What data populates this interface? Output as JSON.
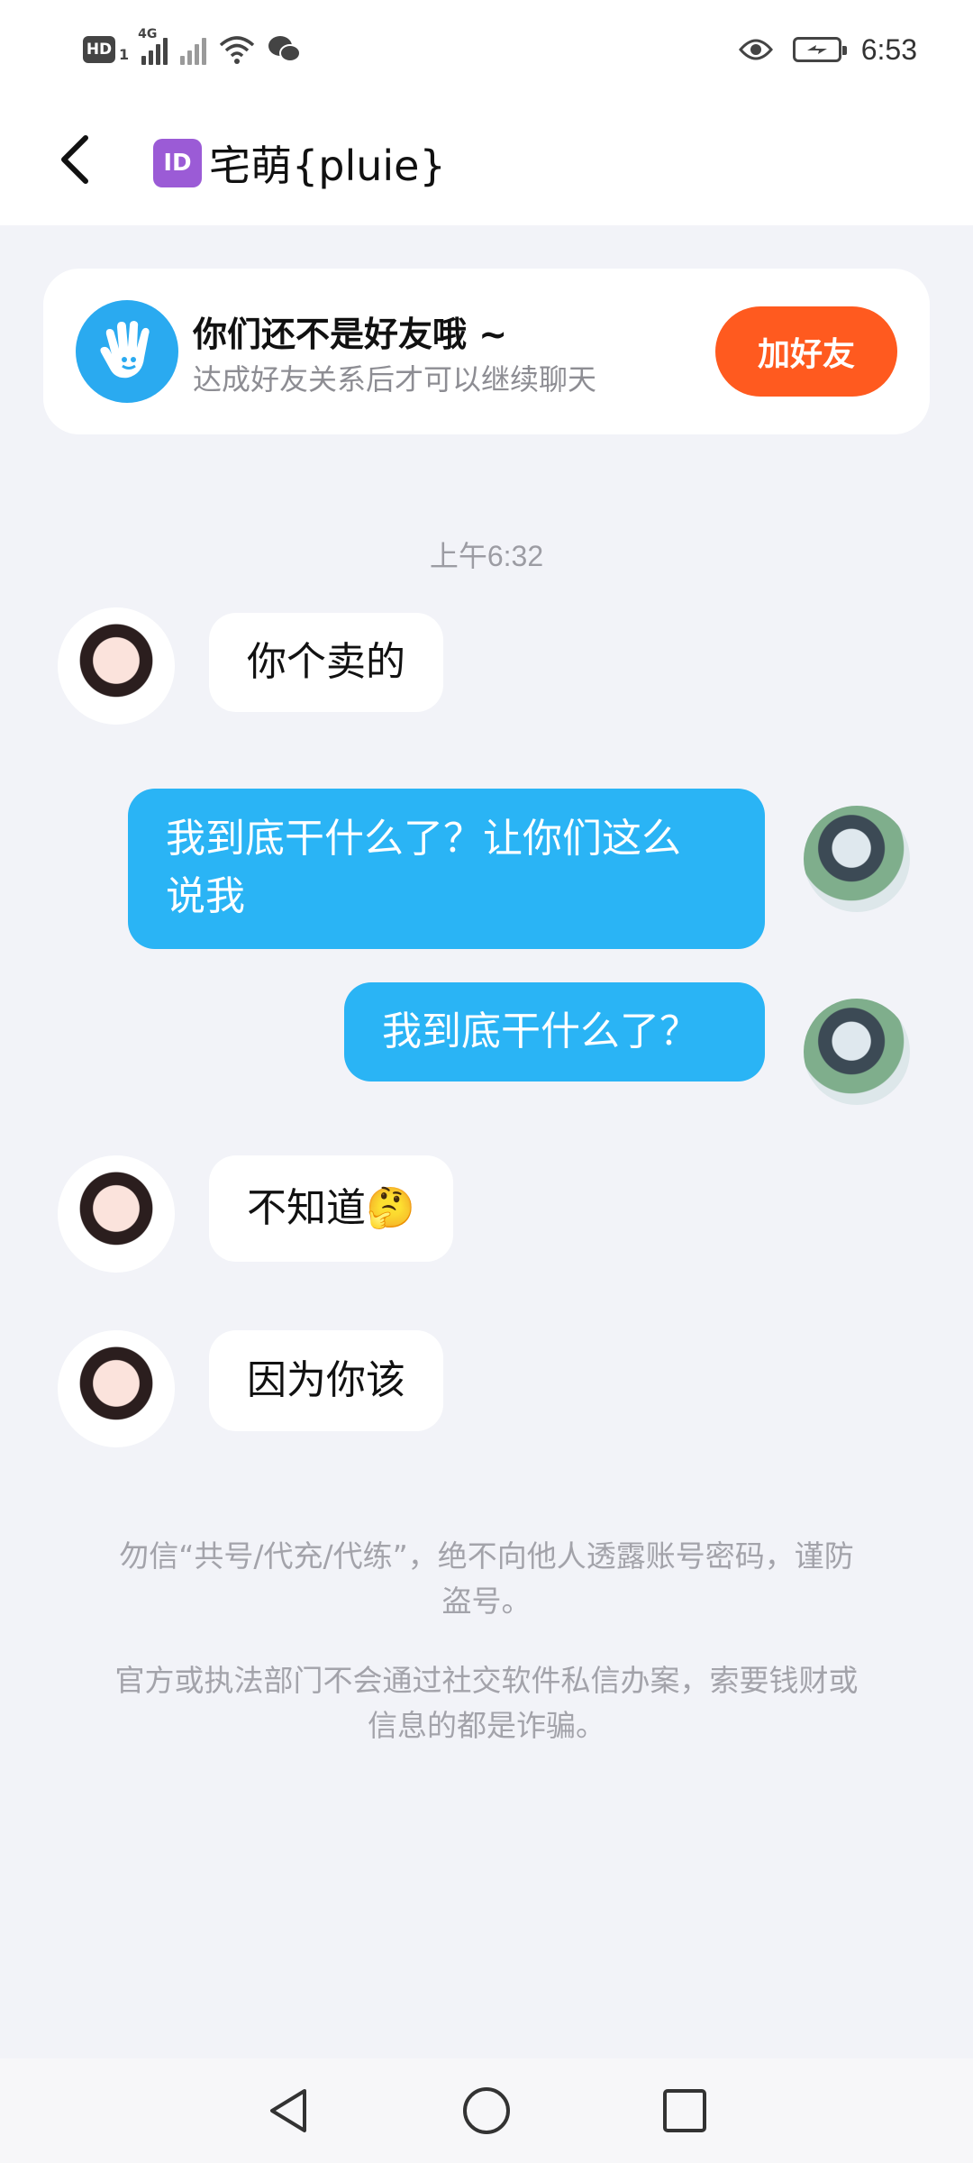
{
  "status_bar": {
    "hd_label": "HD",
    "sim_number": "1",
    "network_label": "4G",
    "time": "6:53"
  },
  "header": {
    "id_badge": "ID",
    "title": "宅萌{pluie}"
  },
  "friend_card": {
    "title": "你们还不是好友哦 ~",
    "subtitle": "达成好友关系后才可以继续聊天",
    "add_button": "加好友"
  },
  "timestamp": "上午6:32",
  "messages": [
    {
      "direction": "in",
      "text": "你个卖的"
    },
    {
      "direction": "out",
      "lines": [
        "我到底干什么了？让你们这么",
        "说我"
      ]
    },
    {
      "direction": "out",
      "text": "我到底干什么了？"
    },
    {
      "direction": "in",
      "text": "不知道",
      "emoji": "🤔"
    },
    {
      "direction": "in",
      "text": "因为你该"
    }
  ],
  "notices": [
    {
      "lines": [
        "勿信“共号/代充/代练”，绝不向他人透露账号密码，谨防",
        "盗号。"
      ]
    },
    {
      "lines": [
        "官方或执法部门不会通过社交软件私信办案，索要钱财或",
        "信息的都是诈骗。"
      ]
    }
  ],
  "colors": {
    "accent_blue": "#2ab4f5",
    "add_friend_orange": "#ff5a1f",
    "background": "#f2f3f8"
  },
  "icons": [
    "back-arrow-icon",
    "wave-hand-icon",
    "eye-icon",
    "battery-icon",
    "wifi-icon",
    "wechat-icon",
    "nav-back-icon",
    "nav-home-icon",
    "nav-recents-icon"
  ]
}
